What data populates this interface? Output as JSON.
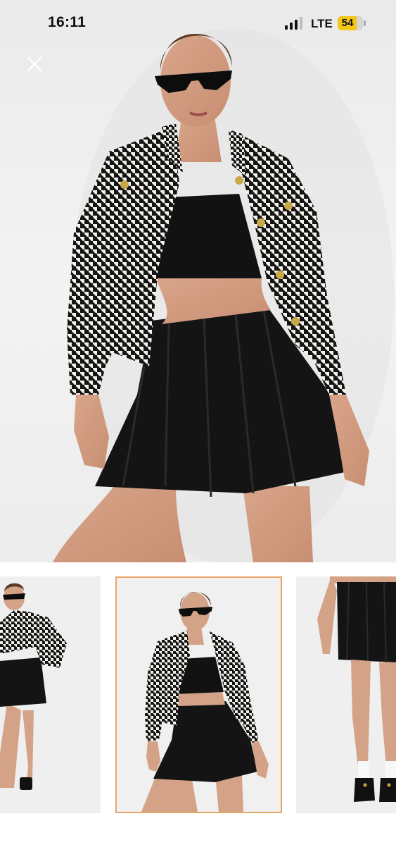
{
  "status_bar": {
    "time": "16:11",
    "network": "LTE",
    "battery": "54",
    "battery_color": "#f5c518"
  },
  "viewer": {
    "close_icon": "close-icon",
    "main_image": "model-houndstooth-jacket-pleated-skirt",
    "thumbnails": [
      {
        "name": "outfit-side-pose",
        "selected": false
      },
      {
        "name": "outfit-front-pose",
        "selected": true
      },
      {
        "name": "skirt-closeup",
        "selected": false
      }
    ],
    "selected_border_color": "#e9a46a"
  }
}
